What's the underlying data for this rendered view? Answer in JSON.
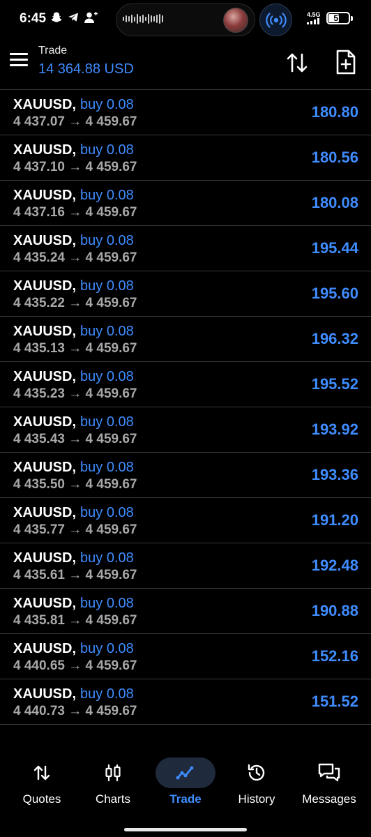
{
  "status_bar": {
    "time": "6:45",
    "network": "4.5G",
    "battery": "57",
    "battery_level": 0.57
  },
  "header": {
    "title": "Trade",
    "balance": "14 364.88 USD"
  },
  "colors": {
    "accent": "#3f8cff",
    "background": "#000000",
    "divider": "#3a3a3a",
    "secondary_text": "#a8a8a8"
  },
  "trades": [
    {
      "symbol": "XAUUSD",
      "type": "buy 0.08",
      "open_price": "4 437.07",
      "current_price": "4 459.67",
      "profit": "180.80"
    },
    {
      "symbol": "XAUUSD",
      "type": "buy 0.08",
      "open_price": "4 437.10",
      "current_price": "4 459.67",
      "profit": "180.56"
    },
    {
      "symbol": "XAUUSD",
      "type": "buy 0.08",
      "open_price": "4 437.16",
      "current_price": "4 459.67",
      "profit": "180.08"
    },
    {
      "symbol": "XAUUSD",
      "type": "buy 0.08",
      "open_price": "4 435.24",
      "current_price": "4 459.67",
      "profit": "195.44"
    },
    {
      "symbol": "XAUUSD",
      "type": "buy 0.08",
      "open_price": "4 435.22",
      "current_price": "4 459.67",
      "profit": "195.60"
    },
    {
      "symbol": "XAUUSD",
      "type": "buy 0.08",
      "open_price": "4 435.13",
      "current_price": "4 459.67",
      "profit": "196.32"
    },
    {
      "symbol": "XAUUSD",
      "type": "buy 0.08",
      "open_price": "4 435.23",
      "current_price": "4 459.67",
      "profit": "195.52"
    },
    {
      "symbol": "XAUUSD",
      "type": "buy 0.08",
      "open_price": "4 435.43",
      "current_price": "4 459.67",
      "profit": "193.92"
    },
    {
      "symbol": "XAUUSD",
      "type": "buy 0.08",
      "open_price": "4 435.50",
      "current_price": "4 459.67",
      "profit": "193.36"
    },
    {
      "symbol": "XAUUSD",
      "type": "buy 0.08",
      "open_price": "4 435.77",
      "current_price": "4 459.67",
      "profit": "191.20"
    },
    {
      "symbol": "XAUUSD",
      "type": "buy 0.08",
      "open_price": "4 435.61",
      "current_price": "4 459.67",
      "profit": "192.48"
    },
    {
      "symbol": "XAUUSD",
      "type": "buy 0.08",
      "open_price": "4 435.81",
      "current_price": "4 459.67",
      "profit": "190.88"
    },
    {
      "symbol": "XAUUSD",
      "type": "buy 0.08",
      "open_price": "4 440.65",
      "current_price": "4 459.67",
      "profit": "152.16"
    },
    {
      "symbol": "XAUUSD",
      "type": "buy 0.08",
      "open_price": "4 440.73",
      "current_price": "4 459.67",
      "profit": "151.52"
    }
  ],
  "nav": [
    {
      "label": "Quotes",
      "icon": "quotes-icon",
      "active": false
    },
    {
      "label": "Charts",
      "icon": "charts-icon",
      "active": false
    },
    {
      "label": "Trade",
      "icon": "trade-icon",
      "active": true
    },
    {
      "label": "History",
      "icon": "history-icon",
      "active": false
    },
    {
      "label": "Messages",
      "icon": "messages-icon",
      "active": false
    }
  ]
}
